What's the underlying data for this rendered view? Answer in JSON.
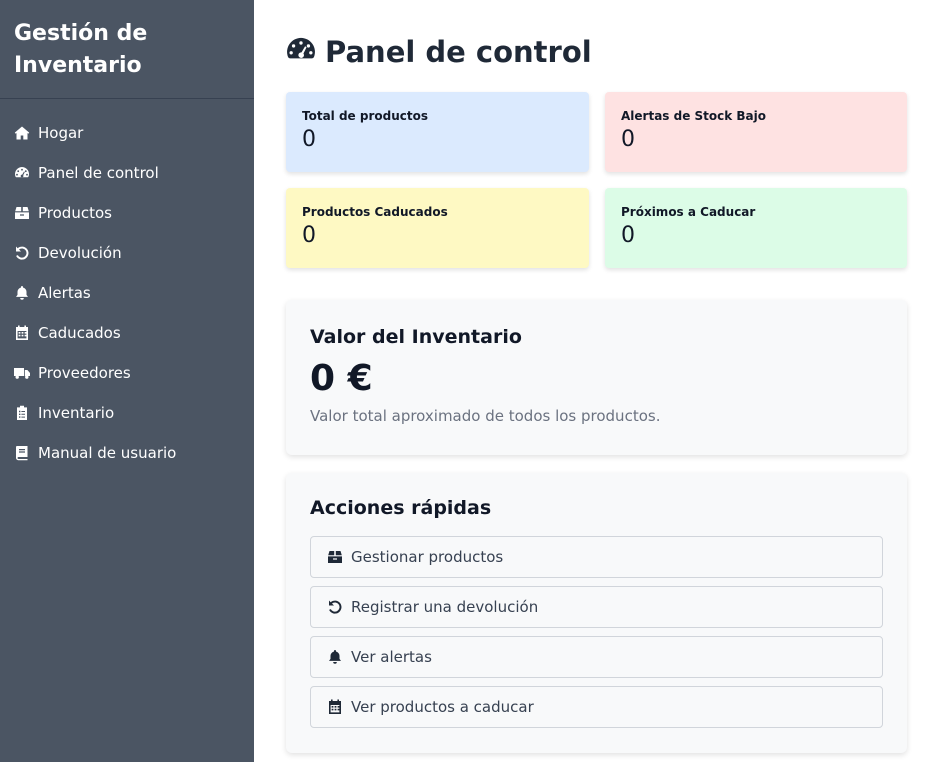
{
  "sidebar": {
    "brand": "Gestión de Inventario",
    "items": [
      {
        "label": "Hogar",
        "icon": "home-icon"
      },
      {
        "label": "Panel de control",
        "icon": "gauge-icon"
      },
      {
        "label": "Productos",
        "icon": "box-icon"
      },
      {
        "label": "Devolución",
        "icon": "undo-icon"
      },
      {
        "label": "Alertas",
        "icon": "bell-icon"
      },
      {
        "label": "Caducados",
        "icon": "calendar-icon"
      },
      {
        "label": "Proveedores",
        "icon": "truck-icon"
      },
      {
        "label": "Inventario",
        "icon": "clipboard-icon"
      },
      {
        "label": "Manual de usuario",
        "icon": "book-icon"
      }
    ]
  },
  "header": {
    "title": "Panel de control",
    "icon": "gauge-icon"
  },
  "stats": [
    {
      "label": "Total de productos",
      "value": "0",
      "color": "#dbeafe"
    },
    {
      "label": "Alertas de Stock Bajo",
      "value": "0",
      "color": "#fee2e2"
    },
    {
      "label": "Productos Caducados",
      "value": "0",
      "color": "#fef9c3"
    },
    {
      "label": "Próximos a Caducar",
      "value": "0",
      "color": "#dcfce7"
    }
  ],
  "inventory_value": {
    "title": "Valor del Inventario",
    "value": "0 €",
    "description": "Valor total aproximado de todos los productos."
  },
  "quick_actions": {
    "title": "Acciones rápidas",
    "items": [
      {
        "label": "Gestionar productos",
        "icon": "box-icon"
      },
      {
        "label": "Registrar una devolución",
        "icon": "undo-icon"
      },
      {
        "label": "Ver alertas",
        "icon": "bell-icon"
      },
      {
        "label": "Ver productos a caducar",
        "icon": "calendar-icon"
      }
    ]
  },
  "colors": {
    "sidebar_bg": "#4b5563",
    "card_bg": "#f8f9fa",
    "text": "#1f2937"
  }
}
